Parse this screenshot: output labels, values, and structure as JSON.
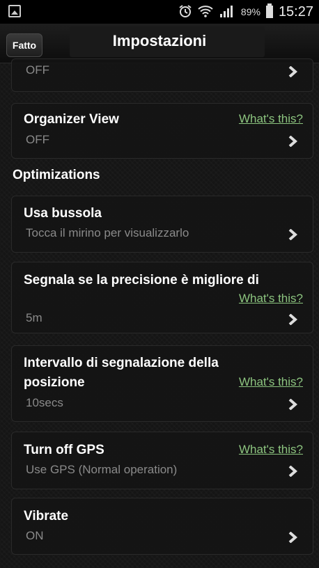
{
  "status_bar": {
    "battery": "89%",
    "time": "15:27",
    "icons": [
      "image-icon",
      "alarm-icon",
      "wifi-icon",
      "signal-icon",
      "battery-icon"
    ]
  },
  "action_bar": {
    "done_label": "Fatto",
    "title": "Impostazioni"
  },
  "settings": {
    "top_partial": {
      "value": "OFF"
    },
    "organizer": {
      "title": "Organizer View",
      "value": "OFF",
      "help": "What's this?"
    },
    "section_optimizations": "Optimizations",
    "compass": {
      "title": "Usa bussola",
      "value": "Tocca il mirino per visualizzarlo"
    },
    "precision": {
      "title": "Segnala se la precisione è migliore di",
      "help": "What's this?",
      "value": "5m"
    },
    "interval": {
      "title_line1": "Intervallo di segnalazione della",
      "title_line2": "posizione",
      "help": "What's this?",
      "value": "10secs"
    },
    "gps": {
      "title": "Turn off GPS",
      "help": "What's this?",
      "value": "Use GPS (Normal operation)"
    },
    "vibrate": {
      "title": "Vibrate",
      "value": "ON"
    }
  },
  "colors": {
    "link": "#8cc47f",
    "secondary_text": "#8a8a8a"
  }
}
